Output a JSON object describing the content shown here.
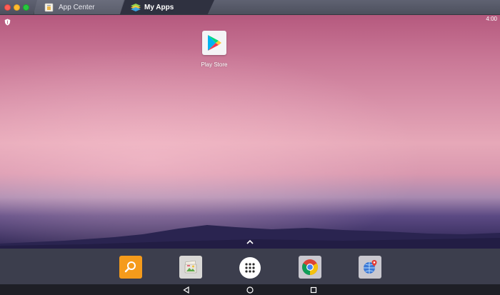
{
  "window": {
    "controls": [
      "close",
      "minimize",
      "maximize"
    ]
  },
  "tabs": [
    {
      "label": "App Center",
      "icon": "app-center-icon",
      "active": false
    },
    {
      "label": "My Apps",
      "icon": "bluestacks-icon",
      "active": true
    }
  ],
  "statusbar": {
    "time": "4:00",
    "left_icon": "shield-icon"
  },
  "home": {
    "shortcuts": [
      {
        "label": "Play Store",
        "icon": "play-store-icon"
      }
    ],
    "drawer_hint_icon": "chevron-up-icon"
  },
  "dock": {
    "items": [
      {
        "icon": "search-icon",
        "color": "#f59b1b"
      },
      {
        "icon": "gallery-icon",
        "color": "#d9d8d6"
      },
      {
        "icon": "app-drawer-icon",
        "color": "#ffffff"
      },
      {
        "icon": "chrome-icon",
        "color": "#c9c8cf"
      },
      {
        "icon": "maps-icon",
        "color": "#c9c8cf"
      }
    ]
  },
  "navbar": {
    "buttons": [
      "back-icon",
      "home-icon",
      "recents-icon"
    ]
  },
  "colors": {
    "titlebar": "#55586a",
    "dock": "#3c3e4d",
    "navbar": "#1e1f26",
    "wallpaper_top": "#b5597e",
    "wallpaper_horizon": "#e6a8b8"
  }
}
